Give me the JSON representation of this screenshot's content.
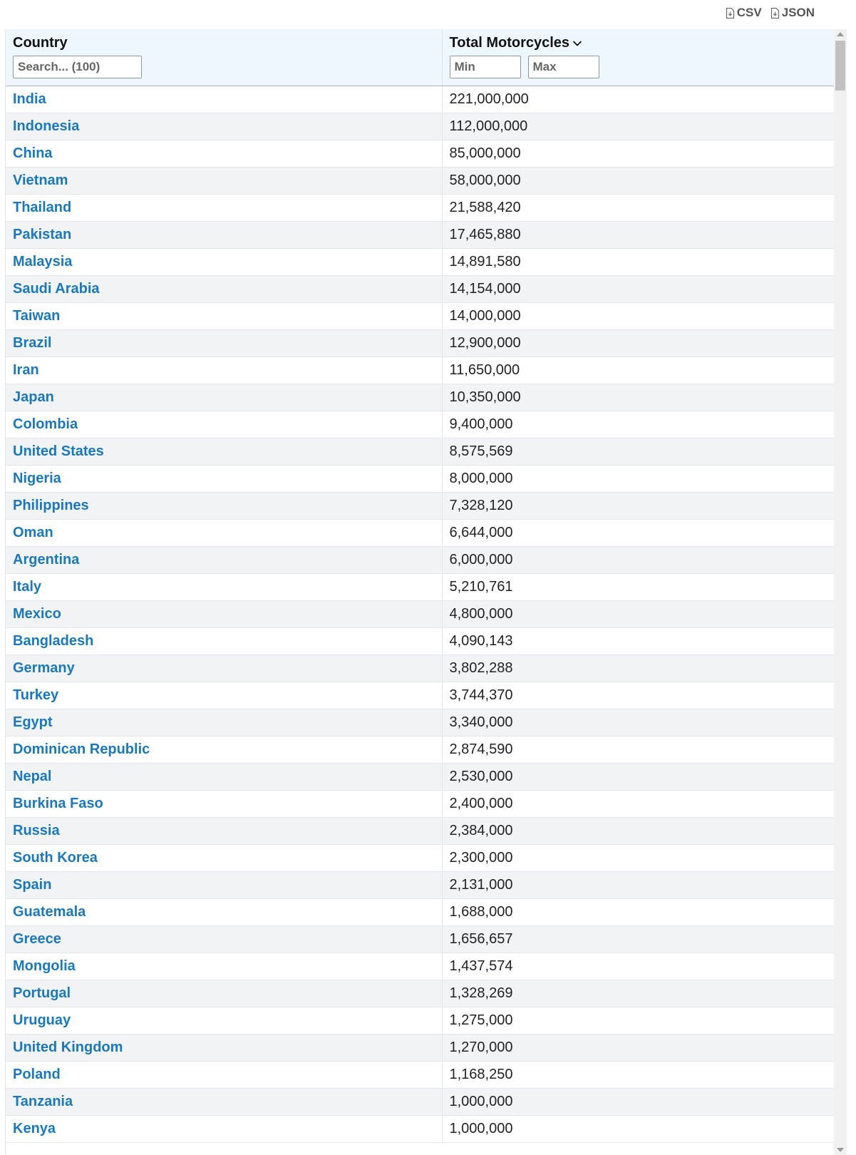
{
  "export": {
    "csv_label": "CSV",
    "json_label": "JSON"
  },
  "table": {
    "columns": {
      "country_header": "Country",
      "country_search_placeholder": "Search... (100)",
      "total_header": "Total Motorcycles",
      "min_placeholder": "Min",
      "max_placeholder": "Max"
    },
    "sort": {
      "column": "Total Motorcycles",
      "direction": "descending"
    },
    "rows": [
      {
        "country": "India",
        "total": "221,000,000"
      },
      {
        "country": "Indonesia",
        "total": "112,000,000"
      },
      {
        "country": "China",
        "total": "85,000,000"
      },
      {
        "country": "Vietnam",
        "total": "58,000,000"
      },
      {
        "country": "Thailand",
        "total": "21,588,420"
      },
      {
        "country": "Pakistan",
        "total": "17,465,880"
      },
      {
        "country": "Malaysia",
        "total": "14,891,580"
      },
      {
        "country": "Saudi Arabia",
        "total": "14,154,000"
      },
      {
        "country": "Taiwan",
        "total": "14,000,000"
      },
      {
        "country": "Brazil",
        "total": "12,900,000"
      },
      {
        "country": "Iran",
        "total": "11,650,000"
      },
      {
        "country": "Japan",
        "total": "10,350,000"
      },
      {
        "country": "Colombia",
        "total": "9,400,000"
      },
      {
        "country": "United States",
        "total": "8,575,569"
      },
      {
        "country": "Nigeria",
        "total": "8,000,000"
      },
      {
        "country": "Philippines",
        "total": "7,328,120"
      },
      {
        "country": "Oman",
        "total": "6,644,000"
      },
      {
        "country": "Argentina",
        "total": "6,000,000"
      },
      {
        "country": "Italy",
        "total": "5,210,761"
      },
      {
        "country": "Mexico",
        "total": "4,800,000"
      },
      {
        "country": "Bangladesh",
        "total": "4,090,143"
      },
      {
        "country": "Germany",
        "total": "3,802,288"
      },
      {
        "country": "Turkey",
        "total": "3,744,370"
      },
      {
        "country": "Egypt",
        "total": "3,340,000"
      },
      {
        "country": "Dominican Republic",
        "total": "2,874,590"
      },
      {
        "country": "Nepal",
        "total": "2,530,000"
      },
      {
        "country": "Burkina Faso",
        "total": "2,400,000"
      },
      {
        "country": "Russia",
        "total": "2,384,000"
      },
      {
        "country": "South Korea",
        "total": "2,300,000"
      },
      {
        "country": "Spain",
        "total": "2,131,000"
      },
      {
        "country": "Guatemala",
        "total": "1,688,000"
      },
      {
        "country": "Greece",
        "total": "1,656,657"
      },
      {
        "country": "Mongolia",
        "total": "1,437,574"
      },
      {
        "country": "Portugal",
        "total": "1,328,269"
      },
      {
        "country": "Uruguay",
        "total": "1,275,000"
      },
      {
        "country": "United Kingdom",
        "total": "1,270,000"
      },
      {
        "country": "Poland",
        "total": "1,168,250"
      },
      {
        "country": "Tanzania",
        "total": "1,000,000"
      },
      {
        "country": "Kenya",
        "total": "1,000,000"
      }
    ]
  },
  "icons": {
    "export": "file-download-icon",
    "sort": "chevron-down-icon"
  }
}
